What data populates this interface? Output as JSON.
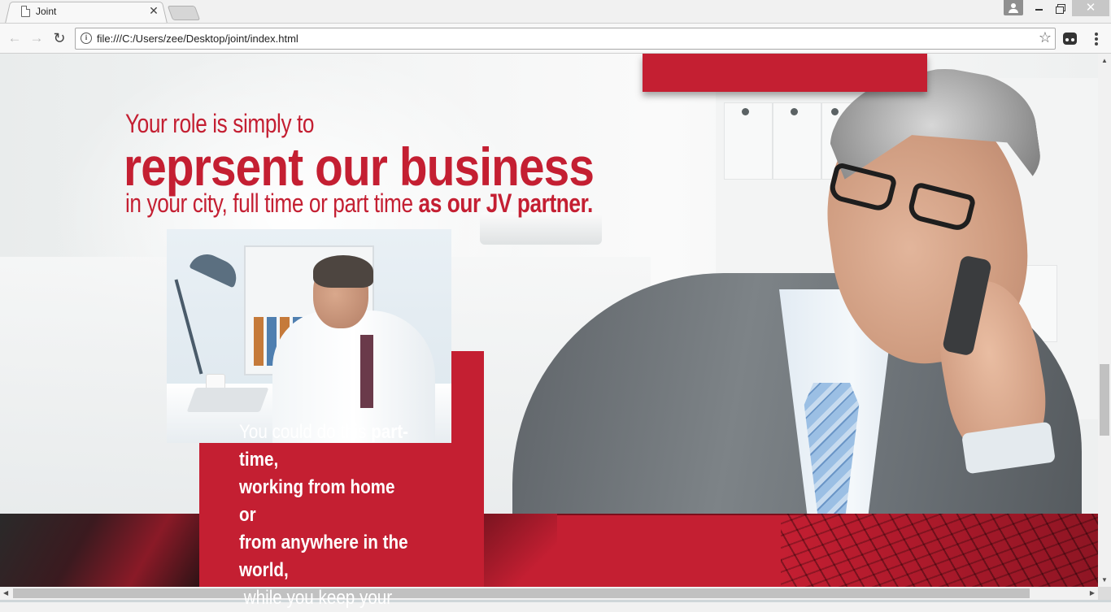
{
  "browser": {
    "tab": {
      "title": "Joint"
    },
    "address_bar": {
      "url": "file:///C:/Users/zee/Desktop/joint/index.html"
    },
    "icons": {
      "tab_page": "page-icon",
      "tab_close": "close-icon",
      "back": "back-arrow-icon",
      "forward": "forward-arrow-icon",
      "reload": "reload-icon",
      "info": "info-icon",
      "bookmark": "star-icon",
      "extension": "extension-icon",
      "menu": "kebab-menu-icon",
      "user": "user-icon"
    }
  },
  "hero": {
    "headline_pre": "Your role is simply to",
    "headline_main": "reprsent our business",
    "headline_sub_plain": "in your city, full time or part time ",
    "headline_sub_bold": "as our JV partner."
  },
  "card": {
    "t1": "You could do this ",
    "t2": "part-time,",
    "t3": "working from home or",
    "t4": "from anywhere in the",
    "t5": "world,",
    "t6": " while you keep your"
  },
  "colors": {
    "brand_red": "#c41f32",
    "chrome_bg": "#f1f1f1"
  }
}
